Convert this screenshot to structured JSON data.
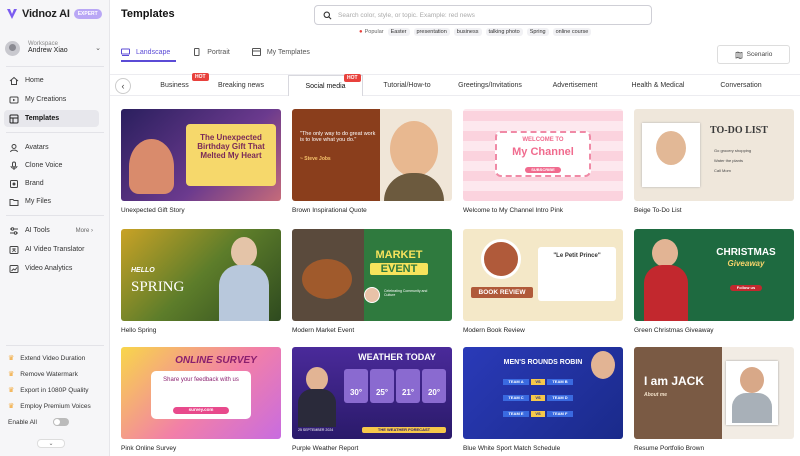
{
  "app": {
    "logo_text": "Vidnoz AI",
    "badge": "EXPERT"
  },
  "workspace": {
    "label": "Workspace",
    "name": "Andrew Xiao"
  },
  "nav": [
    {
      "label": "Home",
      "icon": "home-icon"
    },
    {
      "label": "My Creations",
      "icon": "creations-icon"
    },
    {
      "label": "Templates",
      "icon": "templates-icon"
    },
    {
      "label": "Avatars",
      "icon": "avatar-icon"
    },
    {
      "label": "Clone Voice",
      "icon": "voice-icon"
    },
    {
      "label": "Brand",
      "icon": "brand-icon"
    },
    {
      "label": "My Files",
      "icon": "folder-icon"
    },
    {
      "label": "AI Tools",
      "icon": "tools-icon",
      "more": "More"
    },
    {
      "label": "AI Video Translator",
      "icon": "translate-icon"
    },
    {
      "label": "Video Analytics",
      "icon": "analytics-icon"
    }
  ],
  "promos": [
    "Extend Video Duration",
    "Remove Watermark",
    "Export in 1080P Quality",
    "Employ Premium Voices"
  ],
  "enable_all": "Enable All",
  "collapse_icon": "chevron-down-icon",
  "header": {
    "title": "Templates",
    "search_placeholder": "Search color, style, or topic. Example: red news"
  },
  "popular": {
    "label": "Popular",
    "chips": [
      "Easter",
      "presentation",
      "business",
      "talking photo",
      "Spring",
      "online course"
    ]
  },
  "orientation_tabs": [
    "Landscape",
    "Portrait",
    "My Templates"
  ],
  "scenario": "Scenario",
  "categories": [
    {
      "label": "Business",
      "hot": "HOT"
    },
    {
      "label": "Breaking news"
    },
    {
      "label": "Social media",
      "hot": "HOT"
    },
    {
      "label": "Tutorial/How-to"
    },
    {
      "label": "Greetings/Invitations"
    },
    {
      "label": "Advertisement"
    },
    {
      "label": "Health & Medical"
    },
    {
      "label": "Conversation"
    }
  ],
  "templates": [
    {
      "label": "Unexpected Gift Story",
      "thumb_text": "The Unexpected Birthday Gift That Melted My Heart"
    },
    {
      "label": "Brown Inspirational Quote",
      "thumb_text": "\"The only way to do great work is to love what you do.\"",
      "thumb_sub": "~ Steve Jobs"
    },
    {
      "label": "Welcome to My Channel Intro Pink",
      "thumb_text": "WELCOME TO",
      "thumb_title": "My Channel",
      "thumb_sub": "SUBSCRIBE"
    },
    {
      "label": "Beige To-Do List",
      "thumb_text": "TO-DO LIST",
      "todo": [
        "Go grocery shopping",
        "Water the plants",
        "Call Mom"
      ]
    },
    {
      "label": "Hello Spring",
      "thumb_text": "HELLO",
      "thumb_title": "SPRING"
    },
    {
      "label": "Modern Market Event",
      "thumb_text": "MARKET",
      "thumb_title": "EVENT",
      "thumb_sub": "Celebrating Community and Culture"
    },
    {
      "label": "Modern Book Review",
      "thumb_text": "BOOK REVIEW",
      "thumb_title": "\"Le Petit Prince\""
    },
    {
      "label": "Green Christmas Giveaway",
      "thumb_text": "CHRISTMAS",
      "thumb_title": "Giveaway",
      "thumb_sub": "Follow us"
    },
    {
      "label": "Pink Online Survey",
      "thumb_text": "ONLINE SURVEY",
      "thumb_title": "Share your feedback with us",
      "thumb_sub": "survey.com"
    },
    {
      "label": "Purple Weather Report",
      "thumb_text": "WEATHER TODAY",
      "temps": [
        "30°",
        "25°",
        "21°",
        "20°"
      ],
      "thumb_sub": "THE WEATHER FORECAST",
      "thumb_date": "25 SEPTEMBER 2024"
    },
    {
      "label": "Blue White Sport Match Schedule",
      "thumb_text": "MEN'S ROUNDS ROBIN",
      "teams": [
        "TEAM A",
        "TEAM B",
        "TEAM C",
        "TEAM D",
        "TEAM E",
        "TEAM F"
      ],
      "vs": "VS"
    },
    {
      "label": "Resume Portfolio Brown",
      "thumb_text": "I am JACK",
      "thumb_sub": "About me"
    }
  ],
  "colors": {
    "accent": "#5b4bd6",
    "hot": "#e8413c",
    "star": "#f2a531"
  }
}
